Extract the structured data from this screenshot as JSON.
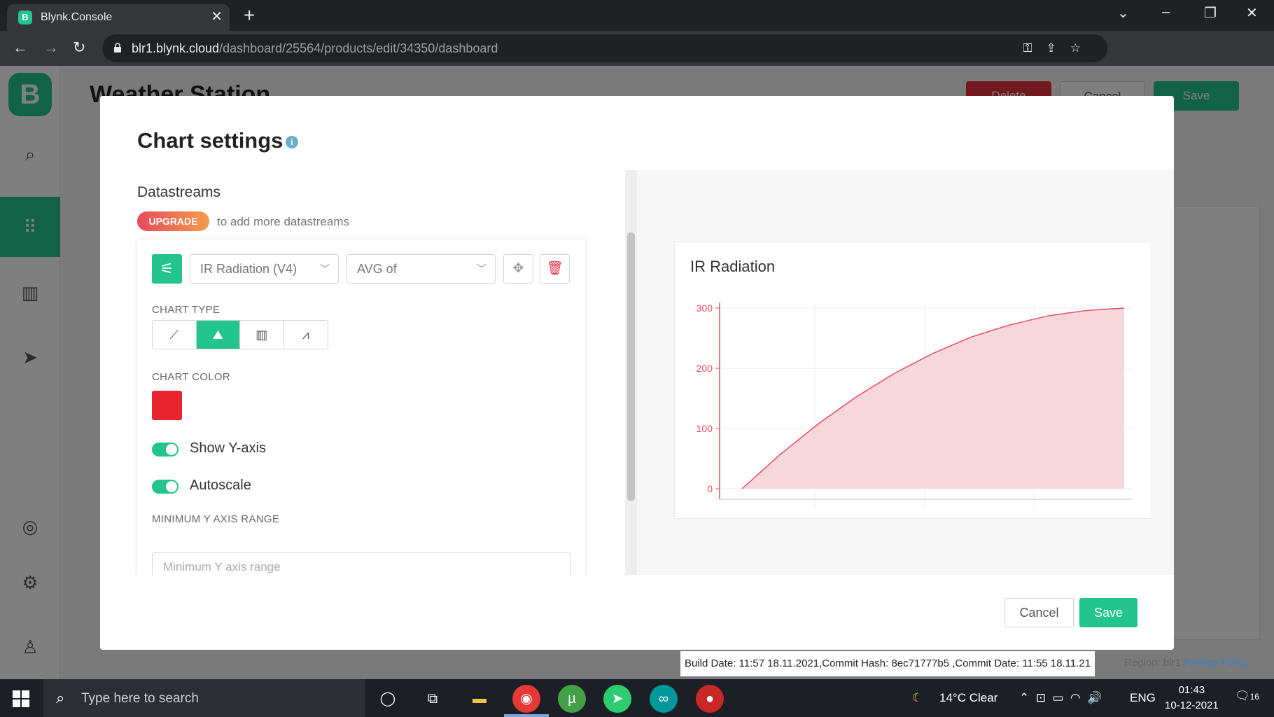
{
  "browser": {
    "tab_title": "Blynk.Console",
    "tab_favicon": "B",
    "url_host": "blr1.blynk.cloud",
    "url_path": "/dashboard/25564/products/edit/34350/dashboard"
  },
  "app": {
    "logo": "B",
    "page_title": "Weather Station",
    "header_buttons": {
      "delete": "Delete",
      "cancel": "Cancel",
      "save": "Save"
    }
  },
  "modal": {
    "title": "Chart settings",
    "datastreams_title": "Datastreams",
    "upgrade_badge": "UPGRADE",
    "upgrade_note": "to add more datastreams",
    "datastream_select": "IR Radiation (V4)",
    "aggregation_select": "AVG of",
    "chart_type_label": "CHART TYPE",
    "chart_color_label": "CHART COLOR",
    "chart_color": "#e8242f",
    "show_y_axis_label": "Show Y-axis",
    "show_y_axis_on": true,
    "autoscale_label": "Autoscale",
    "autoscale_on": true,
    "min_y_label": "MINIMUM Y AXIS RANGE",
    "min_y_placeholder": "Minimum Y axis range",
    "cancel_label": "Cancel",
    "save_label": "Save"
  },
  "chart_data": {
    "type": "area",
    "title": "IR Radiation",
    "xlabel": "",
    "ylabel": "",
    "y_ticks": [
      "300",
      "200",
      "100",
      "0"
    ],
    "ylim": [
      0,
      300
    ],
    "x": [
      0,
      0.1,
      0.2,
      0.3,
      0.4,
      0.5,
      0.6,
      0.7,
      0.8,
      0.9,
      1.0
    ],
    "values": [
      0,
      57,
      108,
      153,
      192,
      225,
      252,
      272,
      287,
      296,
      300
    ],
    "color": "#e84a5f",
    "fill": "#f8d7dc",
    "grid": true
  },
  "footer": {
    "build_info": "Build Date: 11:57 18.11.2021,Commit Hash: 8ec71777b5 ,Commit Date: 11:55 18.11.21",
    "region": "Region: blr1",
    "privacy": "Privacy Policy"
  },
  "taskbar": {
    "search_placeholder": "Type here to search",
    "weather": "14°C  Clear",
    "language": "ENG",
    "time": "01:43",
    "date": "10-12-2021",
    "notifications": "16"
  }
}
